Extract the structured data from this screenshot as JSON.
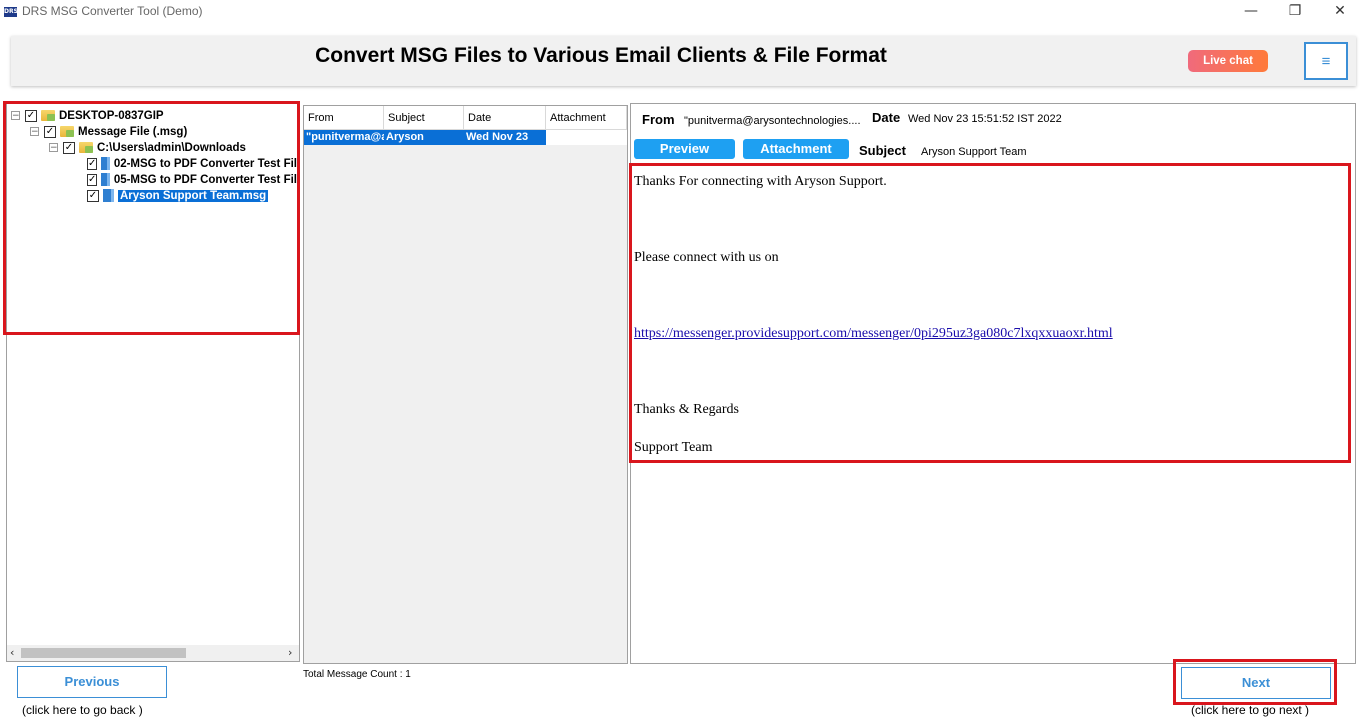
{
  "window": {
    "logo_text": "DRS",
    "title": "DRS MSG Converter Tool (Demo)",
    "minimize_glyph": "—",
    "restore_glyph": "❐",
    "close_glyph": "✕"
  },
  "header": {
    "title": "Convert MSG Files to Various Email Clients & File Format",
    "live_chat_label": "Live chat",
    "menu_glyph": "≡"
  },
  "tree": {
    "items": [
      {
        "label": "DESKTOP-0837GIP",
        "expander": "−",
        "checked": true,
        "icon": "computer-folder-icon"
      },
      {
        "label": "Message File (.msg)",
        "expander": "−",
        "checked": true,
        "icon": "folder-icon"
      },
      {
        "label": "C:\\Users\\admin\\Downloads",
        "expander": "−",
        "checked": true,
        "icon": "folder-icon"
      },
      {
        "label": "02-MSG to PDF Converter Test Fil",
        "checked": true,
        "icon": "file-icon"
      },
      {
        "label": "05-MSG to PDF Converter Test Fil",
        "checked": true,
        "icon": "file-icon"
      },
      {
        "label": "Aryson Support Team.msg",
        "checked": true,
        "icon": "file-icon",
        "selected": true
      }
    ],
    "check_glyph": "✓",
    "scroll_left": "‹",
    "scroll_right": "›"
  },
  "message_list": {
    "columns": [
      "From",
      "Subject",
      "Date",
      "Attachment"
    ],
    "rows": [
      {
        "from": "\"punitverma@arysontechnologies.com\"",
        "subject": "Aryson",
        "date": "Wed Nov 23",
        "attachment": ""
      }
    ],
    "total_label": "Total Message Count : 1"
  },
  "preview": {
    "from_label": "From",
    "from_value": "\"punitverma@arysontechnologies....",
    "date_label": "Date",
    "date_value": "Wed Nov 23 15:51:52 IST 2022",
    "preview_label": "Preview",
    "attachment_label": "Attachment",
    "subject_label": "Subject",
    "subject_value": "Aryson Support Team",
    "body": {
      "line1": "Thanks For connecting with Aryson Support.",
      "line2": "Please connect with us on",
      "link": "https://messenger.providesupport.com/messenger/0pi295uz3ga080c7lxqxxuaoxr.html",
      "line3": "Thanks & Regards",
      "line4": "Support Team"
    }
  },
  "footer": {
    "previous_label": "Previous",
    "previous_hint": "(click here to  go back )",
    "next_label": "Next",
    "next_hint": "(click here to  go next )"
  },
  "colors": {
    "accent_blue": "#1ea0f2",
    "highlight_red": "#d9161d",
    "selection_blue": "#0a6fd6"
  }
}
